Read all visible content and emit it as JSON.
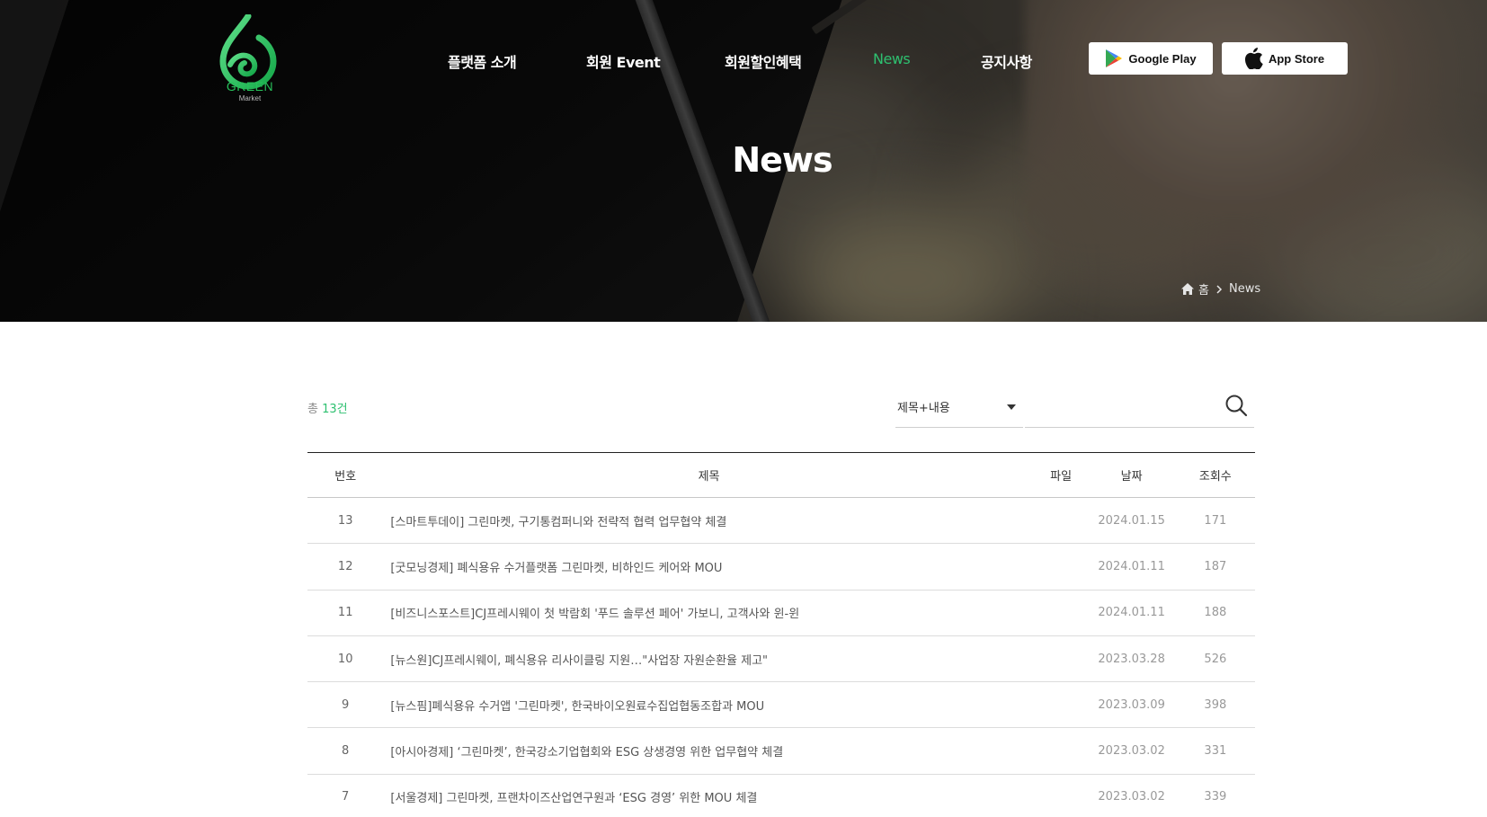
{
  "brand": {
    "logo_text": "GREEN",
    "logo_sub": "Market",
    "accent": "#2ec070"
  },
  "nav": {
    "items": [
      {
        "label": "플랫폼 소개"
      },
      {
        "label": "회원 Event"
      },
      {
        "label": "회원할인혜택"
      },
      {
        "label": "News",
        "active": true
      },
      {
        "label": "공지사항"
      }
    ]
  },
  "stores": {
    "google": "Google Play",
    "apple": "App Store"
  },
  "hero": {
    "title": "News"
  },
  "breadcrumb": {
    "home": "홈",
    "separator": ">",
    "current": "News"
  },
  "board": {
    "total_prefix": "총 ",
    "total_count": "13건",
    "search": {
      "select_value": "제목+내용",
      "placeholder": ""
    },
    "columns": {
      "no": "번호",
      "title": "제목",
      "file": "파일",
      "date": "날짜",
      "views": "조회수"
    },
    "rows": [
      {
        "no": "13",
        "title": "[스마트투데이] 그린마켓, 구기통컴퍼니와 전략적 협력 업무협약 체결",
        "file": "",
        "date": "2024.01.15",
        "views": "171"
      },
      {
        "no": "12",
        "title": "[굿모닝경제] 폐식용유 수거플랫폼 그린마켓, 비하인드 케어와 MOU",
        "file": "",
        "date": "2024.01.11",
        "views": "187"
      },
      {
        "no": "11",
        "title": "[비즈니스포스트]CJ프레시웨이 첫 박람회 '푸드 솔루션 페어' 가보니, 고객사와 윈-윈",
        "file": "",
        "date": "2024.01.11",
        "views": "188"
      },
      {
        "no": "10",
        "title": "[뉴스원]CJ프레시웨이, 폐식용유 리사이클링 지원…\"사업장 자원순환율 제고\"",
        "file": "",
        "date": "2023.03.28",
        "views": "526"
      },
      {
        "no": "9",
        "title": "[뉴스핌]폐식용유 수거앱 '그린마켓', 한국바이오원료수집업협동조합과 MOU",
        "file": "",
        "date": "2023.03.09",
        "views": "398"
      },
      {
        "no": "8",
        "title": "[아시아경제] ‘그린마켓’, 한국강소기업협회와 ESG 상생경영 위한 업무협약 체결",
        "file": "",
        "date": "2023.03.02",
        "views": "331"
      },
      {
        "no": "7",
        "title": "[서울경제] 그린마켓, 프랜차이즈산업연구원과 ‘ESG 경영’ 위한 MOU 체결",
        "file": "",
        "date": "2023.03.02",
        "views": "339"
      }
    ]
  }
}
